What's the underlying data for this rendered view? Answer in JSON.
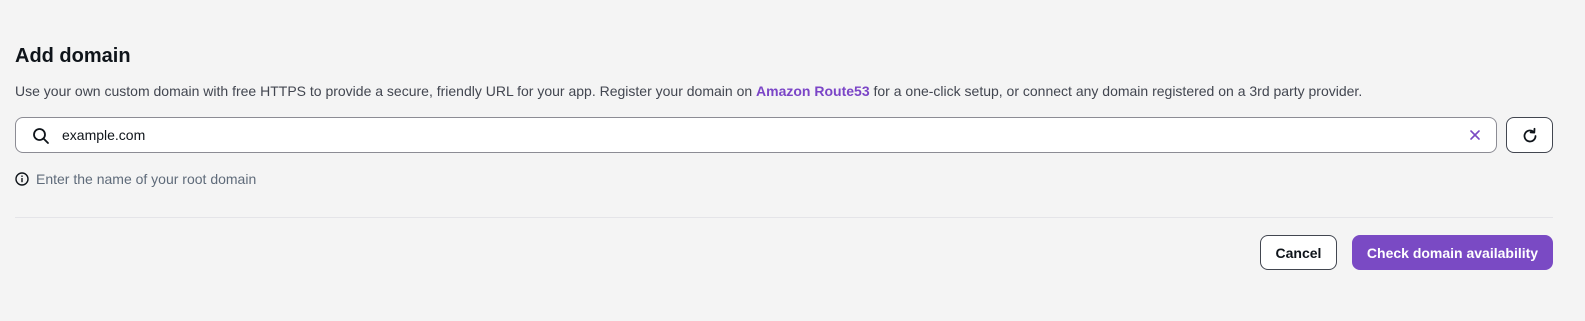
{
  "header": {
    "title": "Add domain"
  },
  "description": {
    "before_link": "Use your own custom domain with free HTTPS to provide a secure, friendly URL for your app. Register your domain on ",
    "link_text": "Amazon Route53",
    "after_link": " for a one-click setup, or connect any domain registered on a 3rd party provider."
  },
  "search": {
    "value": "example.com",
    "icon": "search-icon",
    "clear_icon": "close-icon"
  },
  "refresh": {
    "icon": "refresh-icon"
  },
  "hint": {
    "icon": "info-icon",
    "text": "Enter the name of your root domain"
  },
  "actions": {
    "cancel_label": "Cancel",
    "check_label": "Check domain availability"
  },
  "colors": {
    "accent": "#7a4ac4",
    "link": "#7b45c7",
    "background": "#f4f4f4"
  }
}
